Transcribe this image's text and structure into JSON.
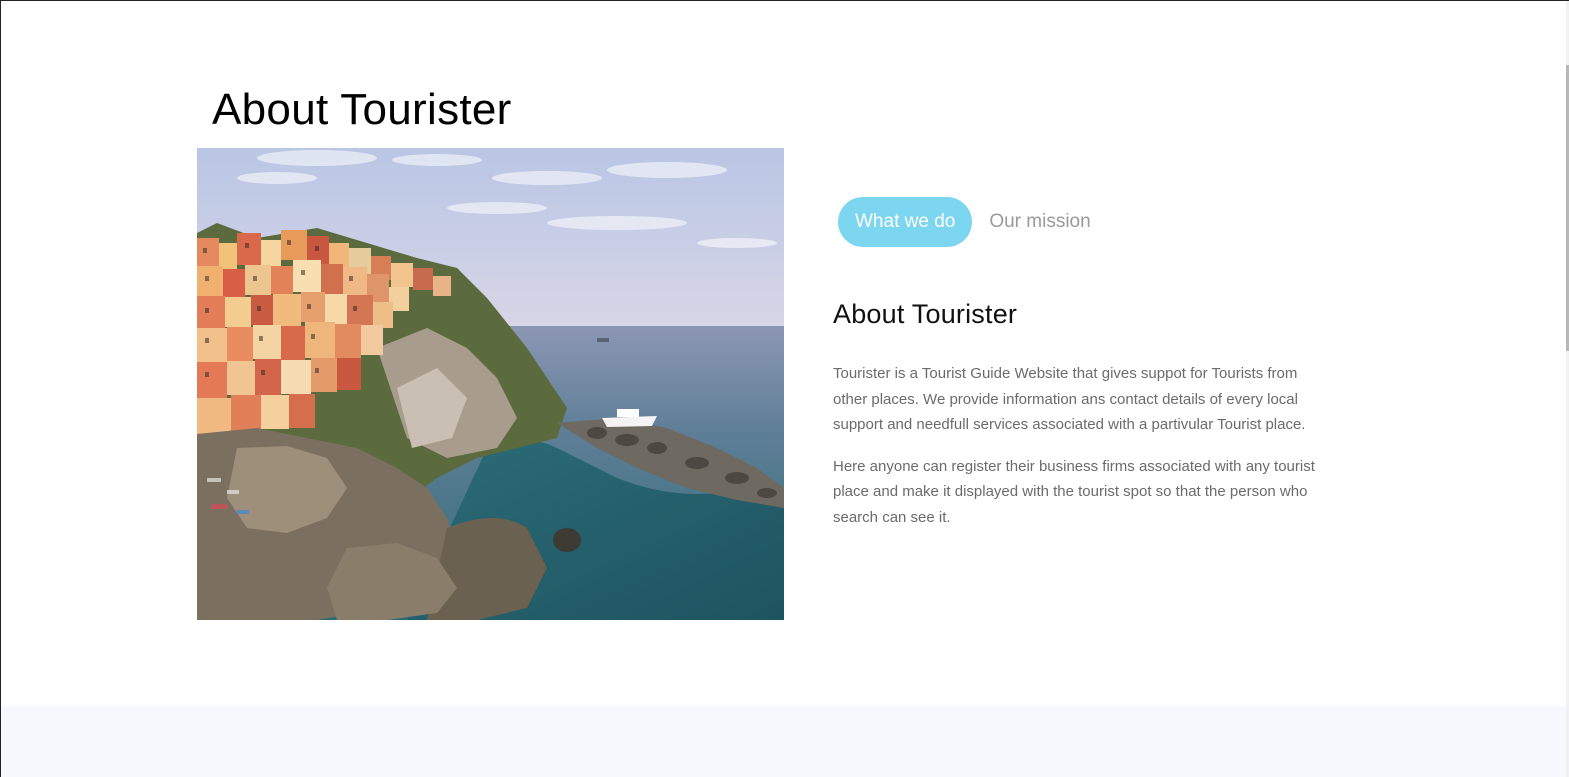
{
  "page": {
    "title": "About Tourister"
  },
  "image": {
    "alt": "Colorful cliffside village above the sea",
    "icon": "coastal-village-photo"
  },
  "tabs": [
    {
      "label": "What we do",
      "active": true
    },
    {
      "label": "Our mission",
      "active": false
    }
  ],
  "content": {
    "heading": "About Tourister",
    "paragraph1": "Tourister is a Tourist Guide Website that gives suppot for Tourists from other places. We provide information ans contact details of every local support and needfull services associated with a partivular Tourist place.",
    "paragraph2": "Here anyone can register their business firms associated with any tourist place and make it displayed with the tourist spot so that the person who search can see it."
  },
  "colors": {
    "accent": "#7dd6ef",
    "inactive_tab": "#9a9a9a",
    "body_text": "#6b6b6b",
    "next_section_bg": "#f7f8fd"
  }
}
